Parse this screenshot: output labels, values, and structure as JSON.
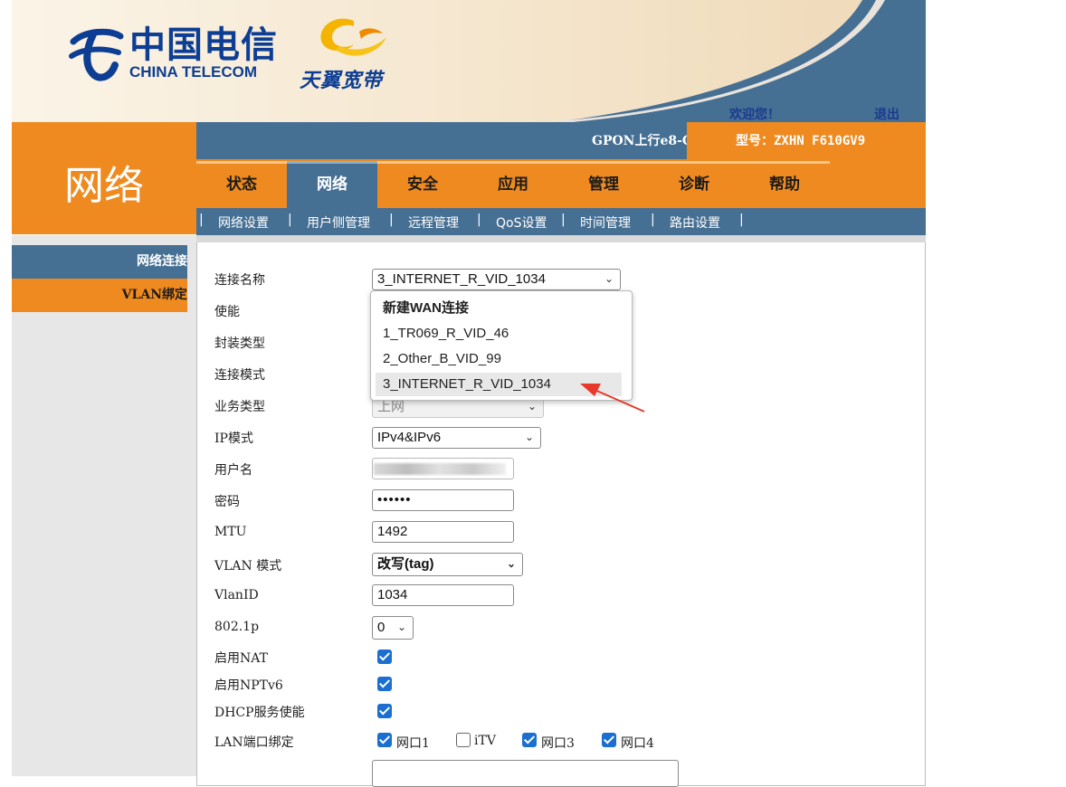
{
  "header": {
    "brand_cn": "中国电信",
    "brand_en": "CHINA TELECOM",
    "sub_brand": "天翼宽带",
    "welcome": "欢迎您！",
    "logout": "退出",
    "device_line": "GPON上行e8-C",
    "model": "型号：ZXHN F610GV9"
  },
  "section_title": "网络",
  "tabs": [
    {
      "label": "状态"
    },
    {
      "label": "网络",
      "active": true
    },
    {
      "label": "安全"
    },
    {
      "label": "应用"
    },
    {
      "label": "管理"
    },
    {
      "label": "诊断"
    },
    {
      "label": "帮助"
    }
  ],
  "subnav": [
    "网络设置",
    "用户侧管理",
    "远程管理",
    "QoS设置",
    "时间管理",
    "路由设置"
  ],
  "sidebar": [
    {
      "label": "网络连接",
      "active": true
    },
    {
      "label": "VLAN绑定"
    }
  ],
  "form": {
    "labels": {
      "conn_name": "连接名称",
      "enable": "使能",
      "encap": "封装类型",
      "conn_mode": "连接模式",
      "service": "业务类型",
      "ip_mode": "IP模式",
      "username": "用户名",
      "password": "密码",
      "mtu": "MTU",
      "vlan_mode": "VLAN 模式",
      "vlan_id": "VlanID",
      "p8021": "802.1p",
      "nat": "启用NAT",
      "nptv6": "启用NPTv6",
      "dhcp": "DHCP服务使能",
      "lan_bind": "LAN端口绑定"
    },
    "conn_name_value": "3_INTERNET_R_VID_1034",
    "service_value": "上网",
    "ip_mode_value": "IPv4&IPv6",
    "password_value": "••••••",
    "mtu_value": "1492",
    "vlan_mode_value": "改写(tag)",
    "vlan_id_value": "1034",
    "p8021_value": "0",
    "nat_checked": true,
    "nptv6_checked": true,
    "dhcp_checked": true,
    "lan_ports": [
      {
        "label": "网口1",
        "checked": true
      },
      {
        "label": "iTV",
        "checked": false
      },
      {
        "label": "网口3",
        "checked": true
      },
      {
        "label": "网口4",
        "checked": true
      }
    ]
  },
  "dropdown_options": [
    {
      "label": "新建WAN连接",
      "bold": true
    },
    {
      "label": "1_TR069_R_VID_46"
    },
    {
      "label": "2_Other_B_VID_99"
    },
    {
      "label": "3_INTERNET_R_VID_1034",
      "highlighted": true
    }
  ],
  "colors": {
    "orange": "#ee8a1f",
    "steel_blue": "#456f93",
    "brand_blue": "#0d3e93",
    "annotation_red": "#e8392b"
  }
}
